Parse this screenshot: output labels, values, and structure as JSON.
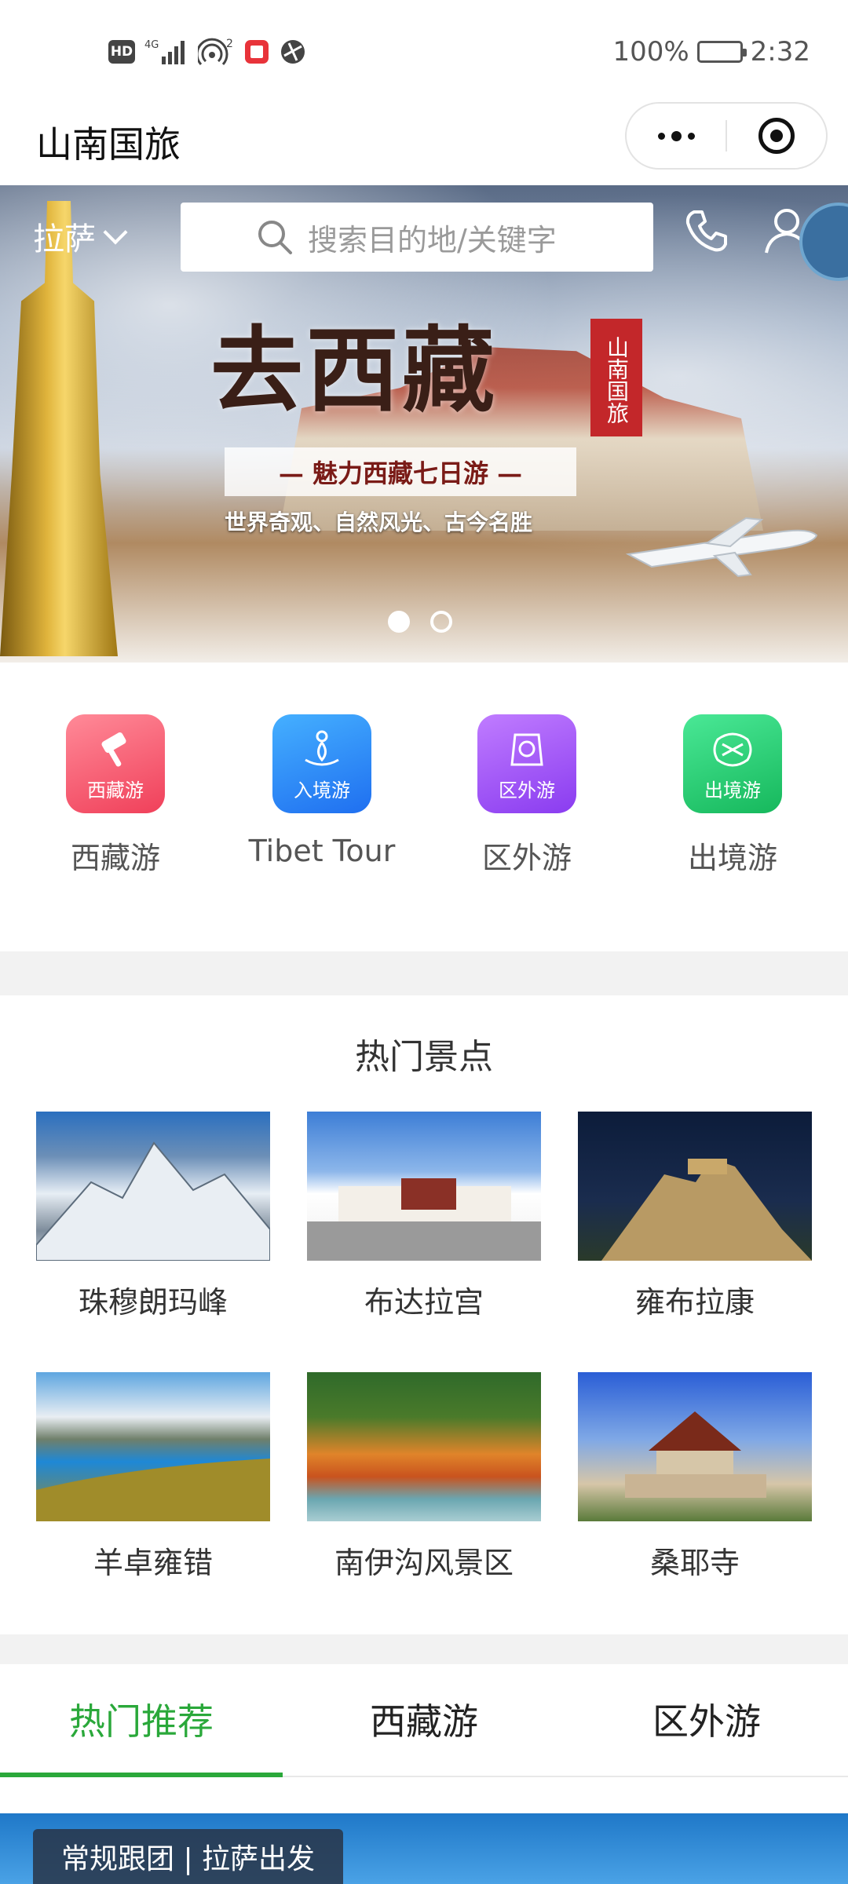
{
  "status_bar": {
    "left_icons": [
      "hd-icon",
      "4g-signal-icon",
      "hotspot-icon",
      "app-notification-icon",
      "browser-icon"
    ],
    "signal_label": "4G",
    "hotspot_count": "2",
    "battery": "100%",
    "time": "2:32"
  },
  "title_bar": {
    "title": "山南国旅",
    "menu_icon": "more-dots-icon",
    "close_icon": "target-close-icon"
  },
  "banner": {
    "city": "拉萨",
    "search_placeholder": "搜索目的地/关键字",
    "headline": "去西藏",
    "seal": "山南国旅",
    "subtitle": "— 魅力西藏七日游 —",
    "tagline": "世界奇观、自然风光、古今名胜",
    "page_count": 2,
    "active_page": 1
  },
  "categories": [
    {
      "badge": "西藏游",
      "label": "西藏游",
      "color_from": "#ff7a8a",
      "color_to": "#f0405a",
      "icon": "hammer-icon"
    },
    {
      "badge": "入境游",
      "label": "Tibet Tour",
      "color_from": "#3aa6ff",
      "color_to": "#1f6ff0",
      "icon": "lotus-icon"
    },
    {
      "badge": "区外游",
      "label": "区外游",
      "color_from": "#b56cff",
      "color_to": "#8a3cf0",
      "icon": "cake-icon"
    },
    {
      "badge": "出境游",
      "label": "出境游",
      "color_from": "#3fe08a",
      "color_to": "#16b85c",
      "icon": "knot-icon"
    }
  ],
  "hot_spots": {
    "title": "热门景点",
    "items": [
      {
        "name": "珠穆朗玛峰",
        "colors": [
          "#2a6fbf",
          "#cfdcea",
          "#6a7a8a"
        ]
      },
      {
        "name": "布达拉宫",
        "colors": [
          "#3d7ed6",
          "#f2f2f2",
          "#8a3026"
        ]
      },
      {
        "name": "雍布拉康",
        "colors": [
          "#0c1c3a",
          "#c9a86a",
          "#5a4a30"
        ]
      },
      {
        "name": "羊卓雍错",
        "colors": [
          "#5ea6e0",
          "#1e88d6",
          "#9c8a2a"
        ]
      },
      {
        "name": "南伊沟风景区",
        "colors": [
          "#2f6a2a",
          "#e0842a",
          "#6aa6b0"
        ]
      },
      {
        "name": "桑耶寺",
        "colors": [
          "#2a5ed6",
          "#7a2a1a",
          "#d6c6a8"
        ]
      }
    ]
  },
  "tabs": [
    {
      "label": "热门推荐",
      "active": true
    },
    {
      "label": "西藏游",
      "active": false
    },
    {
      "label": "区外游",
      "active": false
    }
  ],
  "teaser": {
    "tag": "常规跟团 | 拉萨出发"
  }
}
